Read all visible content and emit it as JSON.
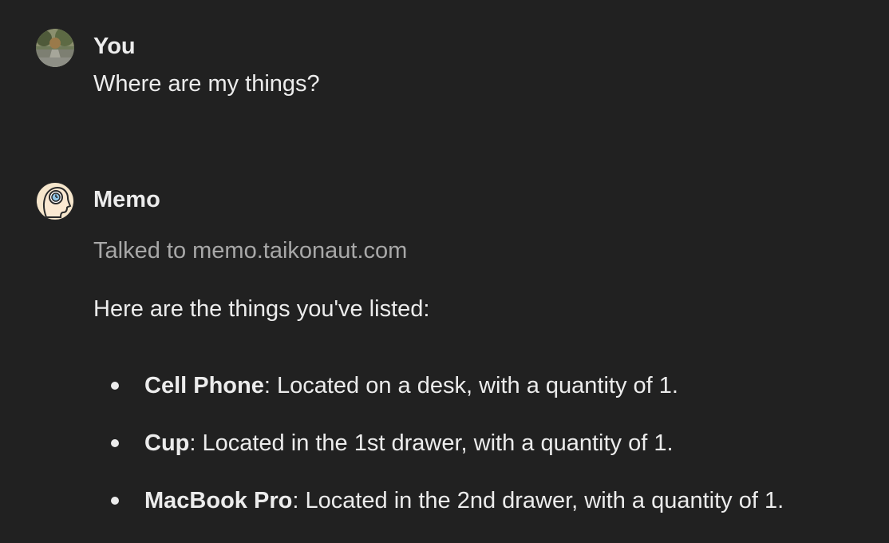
{
  "user_message": {
    "author": "You",
    "avatar_icon": "user-photo-avatar-icon",
    "text": "Where are my things?"
  },
  "assistant_message": {
    "author": "Memo",
    "avatar_icon": "memo-head-avatar-icon",
    "tool_status": "Talked to memo.taikonaut.com",
    "intro": "Here are the things you've listed:",
    "items": [
      {
        "name": "Cell Phone",
        "detail": ": Located on a desk, with a quantity of 1."
      },
      {
        "name": "Cup",
        "detail": ": Located in the 1st drawer, with a quantity of 1."
      },
      {
        "name": "MacBook Pro",
        "detail": ": Located in the 2nd drawer, with a quantity of 1."
      }
    ]
  },
  "colors": {
    "background": "#212121",
    "text": "#ececec",
    "muted_text": "#a8a8a8"
  }
}
